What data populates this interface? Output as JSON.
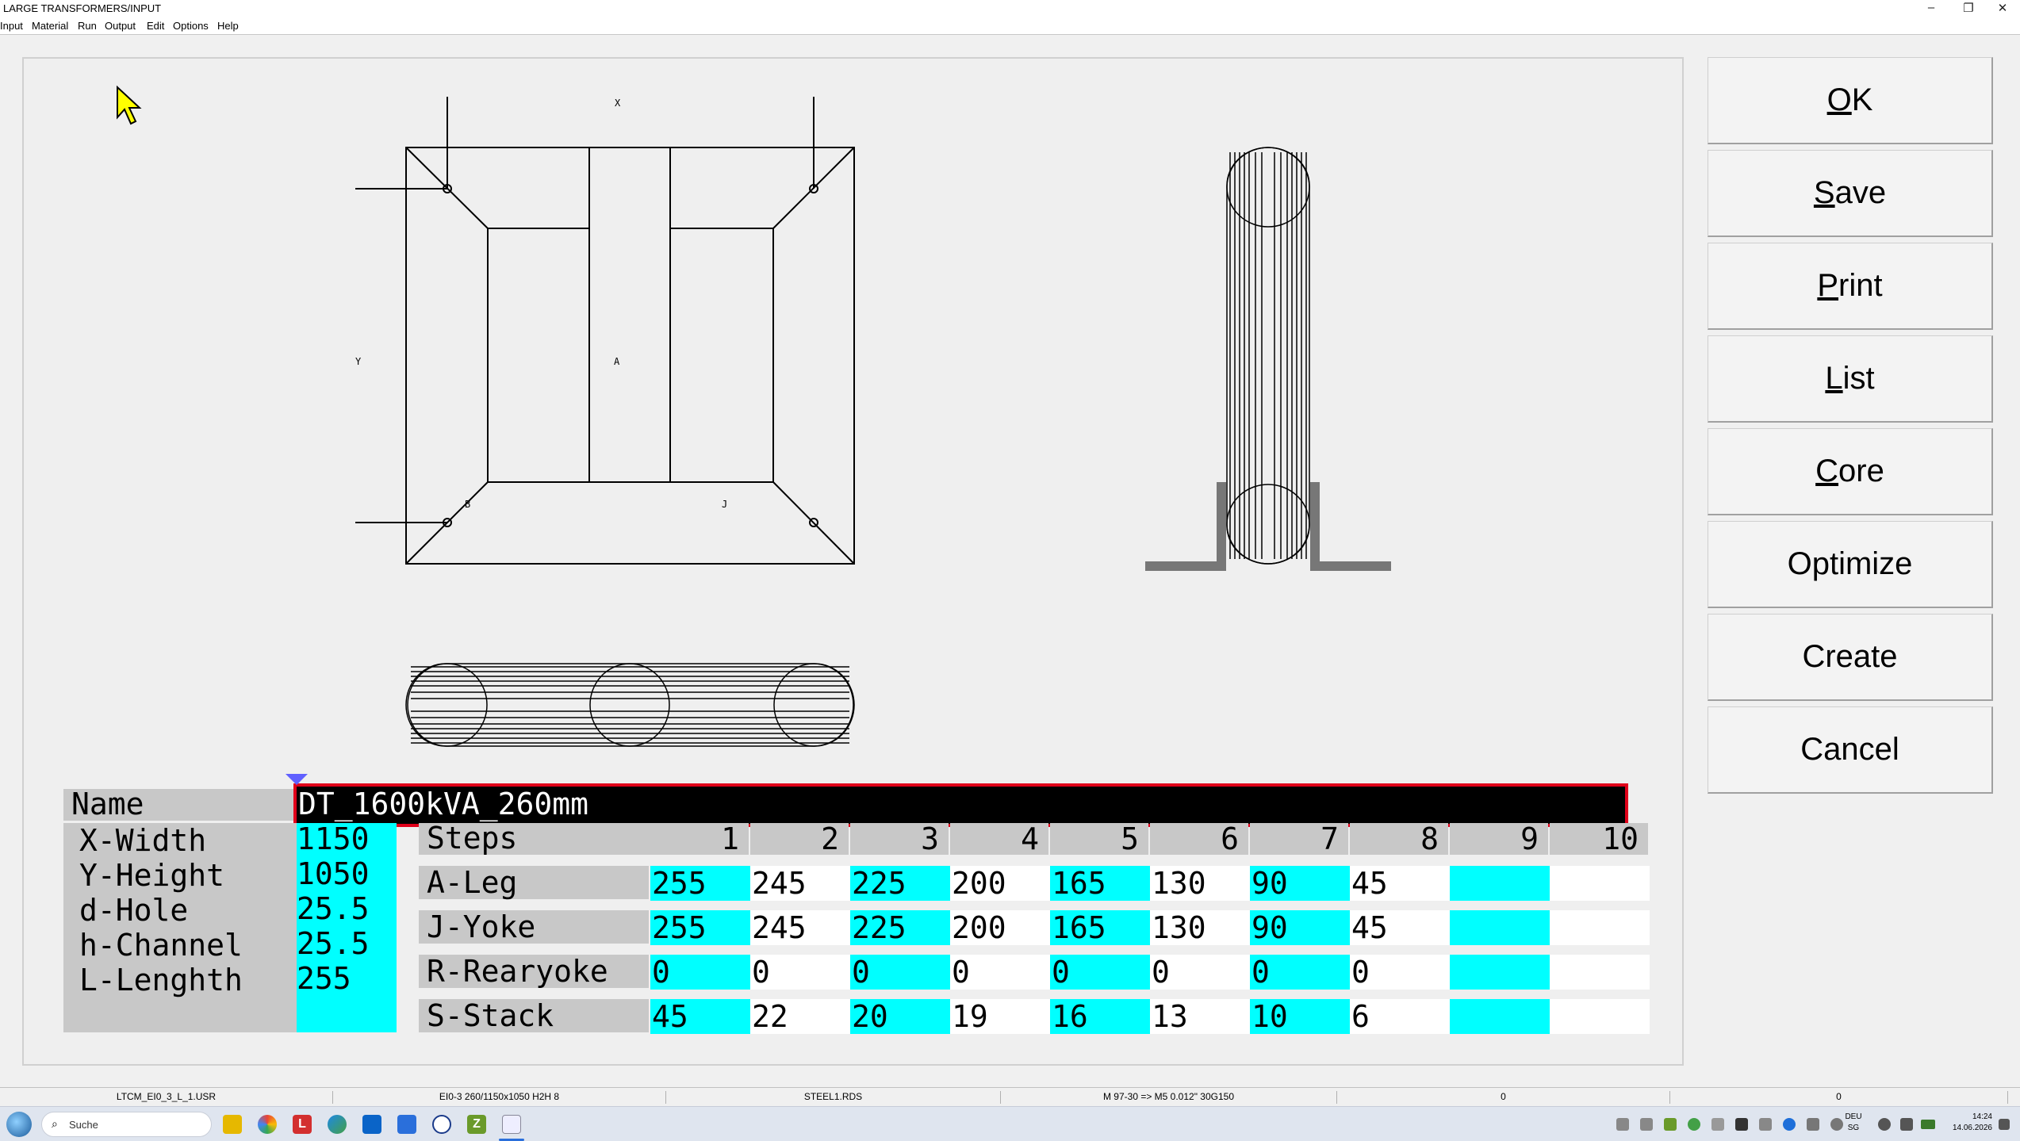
{
  "window": {
    "title": "LARGE TRANSFORMERS/INPUT",
    "controls": [
      "–",
      "❐",
      "✕"
    ]
  },
  "menu": [
    "Input",
    "Material",
    "Run",
    "Output",
    "Edit",
    "Options",
    "Help"
  ],
  "drawing_labels": {
    "x": "X",
    "y": "Y",
    "a": "A",
    "b": "B",
    "j": "J"
  },
  "buttons": [
    {
      "mnemonic": "O",
      "rest": "K"
    },
    {
      "mnemonic": "S",
      "rest": "ave"
    },
    {
      "mnemonic": "P",
      "rest": "rint"
    },
    {
      "mnemonic": "L",
      "rest": "ist"
    },
    {
      "mnemonic": "C",
      "rest": "ore"
    },
    {
      "mnemonic": "",
      "rest": "Optimize"
    },
    {
      "mnemonic": "",
      "rest": "Create"
    },
    {
      "mnemonic": "",
      "rest": "Cancel"
    }
  ],
  "form": {
    "name_label": "Name",
    "name_value": "DT_1600kVA_260mm",
    "params": [
      {
        "label": "X-Width",
        "value": "1150"
      },
      {
        "label": "Y-Height",
        "value": "1050"
      },
      {
        "label": "d-Hole",
        "value": "25.5"
      },
      {
        "label": "h-Channel",
        "value": "25.5"
      },
      {
        "label": "L-Lenghth",
        "value": "255"
      }
    ]
  },
  "steps_table": {
    "header_label": "Steps",
    "columns": [
      "1",
      "2",
      "3",
      "4",
      "5",
      "6",
      "7",
      "8",
      "9",
      "10"
    ],
    "rows": [
      {
        "label": "A-Leg",
        "values": [
          "255",
          "245",
          "225",
          "200",
          "165",
          "130",
          "90",
          "45",
          "",
          ""
        ]
      },
      {
        "label": "J-Yoke",
        "values": [
          "255",
          "245",
          "225",
          "200",
          "165",
          "130",
          "90",
          "45",
          "",
          ""
        ]
      },
      {
        "label": "R-Rearyoke",
        "values": [
          "0",
          "0",
          "0",
          "0",
          "0",
          "0",
          "0",
          "0",
          "",
          ""
        ]
      },
      {
        "label": "S-Stack",
        "values": [
          "45",
          "22",
          "20",
          "19",
          "16",
          "13",
          "10",
          "6",
          "",
          ""
        ]
      }
    ]
  },
  "statusbar": [
    "LTCM_EI0_3_L_1.USR",
    "EI0-3 260/1150x1050 H2H 8",
    "STEEL1.RDS",
    "M 97-30 => M5 0.012\" 30G150",
    "0",
    "0"
  ],
  "taskbar": {
    "search_placeholder": "Suche",
    "lang": "DEU",
    "lang_sub": "SG",
    "time": "14:24",
    "date": "14.06.2026"
  },
  "colors": {
    "cyan": "#00ffff",
    "highlight_border": "#e0001a",
    "label_gray": "#c8c8c8",
    "cursor_yellow": "#ffff00"
  }
}
